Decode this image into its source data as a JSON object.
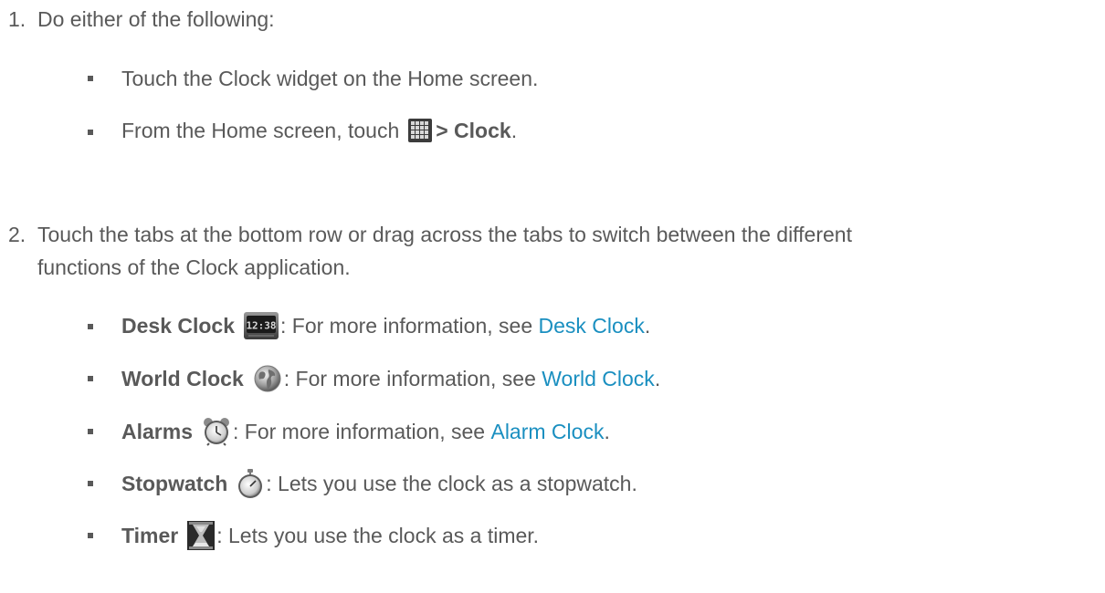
{
  "steps": [
    {
      "number": "1.",
      "text": "Do either of the following:",
      "items": [
        {
          "text": "Touch the Clock widget on the Home screen."
        },
        {
          "prefix": "From the Home screen, touch",
          "bold": "> Clock",
          "suffix": ".",
          "icon": "apps-grid-icon"
        }
      ]
    },
    {
      "number": "2.",
      "line1": "Touch the tabs at the bottom row or drag across the tabs to switch between the different",
      "line2": "functions of the Clock application.",
      "items": [
        {
          "label": "Desk Clock",
          "icon": "desk-clock-icon",
          "text": ": For more information, see ",
          "link": "Desk Clock",
          "end": "."
        },
        {
          "label": "World Clock",
          "icon": "world-clock-icon",
          "text": ": For more information, see ",
          "link": "World Clock",
          "end": "."
        },
        {
          "label": "Alarms",
          "icon": "alarm-clock-icon",
          "text": ": For more information, see ",
          "link": "Alarm Clock",
          "end": "."
        },
        {
          "label": "Stopwatch",
          "icon": "stopwatch-icon",
          "text": ": Lets you use the clock as a stopwatch."
        },
        {
          "label": "Timer",
          "icon": "hourglass-timer-icon",
          "text": ": Lets you use the clock as a timer."
        }
      ]
    }
  ],
  "desk_clock_display": "12:38",
  "colors": {
    "text": "#595959",
    "link": "#1a8fc0"
  }
}
